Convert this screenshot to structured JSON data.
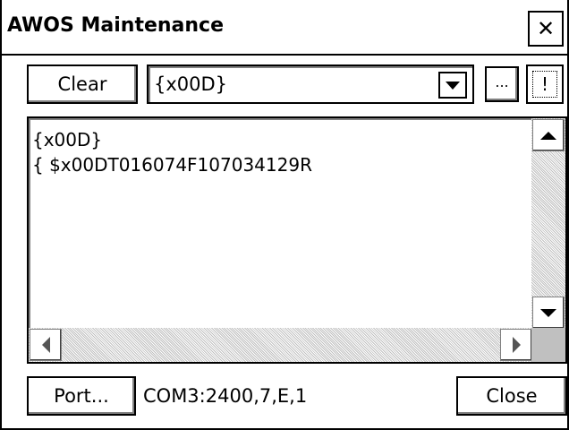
{
  "window": {
    "title": "AWOS Maintenance",
    "close_glyph": "✕"
  },
  "toolbar": {
    "clear_label": "Clear",
    "combo_value": "{x00D}",
    "ellipsis_label": "...",
    "exclaim_label": "!"
  },
  "output": {
    "lines": [
      "{x00D}",
      "{ $x00DT016074F107034129R"
    ]
  },
  "footer": {
    "port_label": "Port...",
    "port_status": "COM3:2400,7,E,1",
    "close_label": "Close"
  },
  "icons": {
    "window_close": "close-icon",
    "combo_dropdown": "chevron-down-icon",
    "scroll_up": "arrow-up-icon",
    "scroll_down": "arrow-down-icon",
    "scroll_left": "arrow-left-icon",
    "scroll_right": "arrow-right-icon"
  }
}
